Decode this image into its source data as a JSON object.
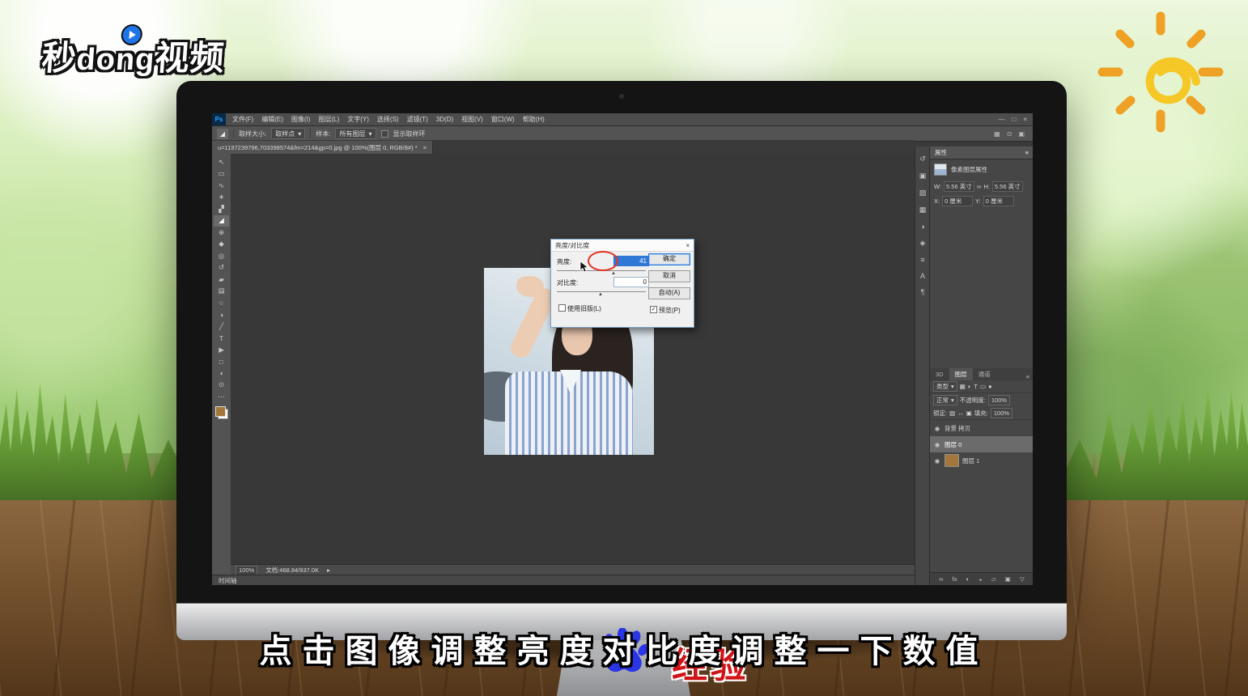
{
  "branding": {
    "logo": {
      "part1": "秒",
      "part2": "dong",
      "part3": "视频"
    },
    "caption": "点击图像调整亮度对比度调整一下数值",
    "watermark": "经验"
  },
  "colors": {
    "ps_panel": "#535353",
    "ps_canvas": "#383838",
    "selection_blue": "#2f78d6",
    "annotation_red": "#e23320",
    "baidu_blue": "#2a35e6",
    "watermark_red": "#cf1418",
    "foreground_swatch": "#a5763a"
  },
  "ps": {
    "badge": "Ps",
    "menu": [
      "文件(F)",
      "编辑(E)",
      "图像(I)",
      "图层(L)",
      "文字(Y)",
      "选择(S)",
      "滤镜(T)",
      "3D(D)",
      "视图(V)",
      "窗口(W)",
      "帮助(H)"
    ],
    "window_controls": {
      "min": "—",
      "restore": "□",
      "close": "×"
    },
    "options": {
      "tool_glyph": "◢",
      "sample_size_label": "取样大小:",
      "sample_size_value": "取样点",
      "sample_label": "样本:",
      "sample_value": "所有图层",
      "show_ring": "显示取样环",
      "caret": "▾",
      "right_icons": [
        {
          "name": "workspace-icon",
          "glyph": "▦"
        },
        {
          "name": "search-icon",
          "glyph": "⊙"
        },
        {
          "name": "grid-icon",
          "glyph": "▣"
        }
      ]
    },
    "doc_tab": {
      "title": "u=1197239796,703398574&fm=214&gp=0.jpg @ 100%(图层 0, RGB/8#) *",
      "close": "×"
    },
    "tools": [
      {
        "name": "move-tool",
        "glyph": "↖"
      },
      {
        "name": "rectangular-marquee-tool",
        "glyph": "▭"
      },
      {
        "name": "lasso-tool",
        "glyph": "∿"
      },
      {
        "name": "quick-selection-tool",
        "glyph": "∗"
      },
      {
        "name": "crop-tool",
        "glyph": "▞"
      },
      {
        "name": "eyedropper-tool",
        "glyph": "◢"
      },
      {
        "name": "healing-brush-tool",
        "glyph": "⊕"
      },
      {
        "name": "brush-tool",
        "glyph": "◆"
      },
      {
        "name": "clone-stamp-tool",
        "glyph": "◎"
      },
      {
        "name": "history-brush-tool",
        "glyph": "↺"
      },
      {
        "name": "eraser-tool",
        "glyph": "▰"
      },
      {
        "name": "gradient-tool",
        "glyph": "▤"
      },
      {
        "name": "blur-tool",
        "glyph": "○"
      },
      {
        "name": "dodge-tool",
        "glyph": "◑"
      },
      {
        "name": "pen-tool",
        "glyph": "╱"
      },
      {
        "name": "type-tool",
        "glyph": "T"
      },
      {
        "name": "path-selection-tool",
        "glyph": "▶"
      },
      {
        "name": "shape-tool",
        "glyph": "□"
      },
      {
        "name": "hand-tool",
        "glyph": "◖"
      },
      {
        "name": "zoom-tool",
        "glyph": "⊙"
      },
      {
        "name": "toolbar-more",
        "glyph": "⋯"
      }
    ],
    "dock": [
      {
        "name": "history-panel-icon",
        "glyph": "↺"
      },
      {
        "name": "snapshot-panel-icon",
        "glyph": "▣"
      },
      {
        "name": "color-panel-icon",
        "glyph": "▨"
      },
      {
        "name": "swatches-panel-icon",
        "glyph": "▦"
      },
      {
        "name": "adjustments-panel-icon",
        "glyph": "◑"
      },
      {
        "name": "styles-panel-icon",
        "glyph": "◈"
      },
      {
        "name": "info-panel-icon",
        "glyph": "≡"
      },
      {
        "name": "character-panel-icon",
        "glyph": "A"
      },
      {
        "name": "paragraph-panel-icon",
        "glyph": "¶"
      }
    ],
    "props": {
      "title": "属性",
      "menu_icon": "≡",
      "subtitle": "像素图层属性",
      "w_label": "W:",
      "w_value": "5.56 英寸",
      "h_label": "H:",
      "h_value": "5.56 英寸",
      "link": "∞",
      "x_label": "X:",
      "x_value": "0 厘米",
      "y_label": "Y:",
      "y_value": "0 厘米"
    },
    "layers_panel": {
      "tabs": [
        "3D",
        "图层",
        "通道"
      ],
      "menu_icon": "≡",
      "filter_label": "类型",
      "caret": "▾",
      "filter_icons": [
        {
          "name": "filter-pixel-icon",
          "glyph": "▦"
        },
        {
          "name": "filter-adjustment-icon",
          "glyph": "◐"
        },
        {
          "name": "filter-type-icon",
          "glyph": "T"
        },
        {
          "name": "filter-shape-icon",
          "glyph": "▭"
        },
        {
          "name": "filter-smart-icon",
          "glyph": "●"
        }
      ],
      "blend_mode": "正常",
      "opacity_label": "不透明度:",
      "opacity_value": "100%",
      "lock_label": "锁定:",
      "lock_icons": [
        {
          "name": "lock-transparency-icon",
          "glyph": "▨"
        },
        {
          "name": "lock-position-icon",
          "glyph": "↔"
        },
        {
          "name": "lock-all-icon",
          "glyph": "▣"
        }
      ],
      "fill_label": "填充:",
      "fill_value": "100%",
      "eye_glyph": "◉",
      "layers": [
        {
          "name": "背景 拷贝"
        },
        {
          "name": "图层 0"
        },
        {
          "name": "图层 1"
        }
      ],
      "bottom_icons": [
        {
          "name": "link-layers-icon",
          "glyph": "∞"
        },
        {
          "name": "layer-style-icon",
          "glyph": "fx"
        },
        {
          "name": "layer-mask-icon",
          "glyph": "◐"
        },
        {
          "name": "adjustment-layer-icon",
          "glyph": "◒"
        },
        {
          "name": "layer-group-icon",
          "glyph": "▱"
        },
        {
          "name": "new-layer-icon",
          "glyph": "▣"
        },
        {
          "name": "delete-layer-icon",
          "glyph": "▽"
        }
      ]
    },
    "dialog": {
      "title": "亮度/对比度",
      "close": "×",
      "brightness_label": "亮度:",
      "brightness_value": "41",
      "contrast_label": "对比度:",
      "contrast_value": "0",
      "legacy_label": "使用旧版(L)",
      "ok": "确定",
      "cancel": "取消",
      "auto": "自动(A)",
      "preview": "预览(P)",
      "check": "✓",
      "thumb_glyph": "▲"
    },
    "status": {
      "zoom": "100%",
      "doc": "文档:468.84/937.0K",
      "arrow": "▸"
    },
    "timeline_label": "时间轴"
  }
}
